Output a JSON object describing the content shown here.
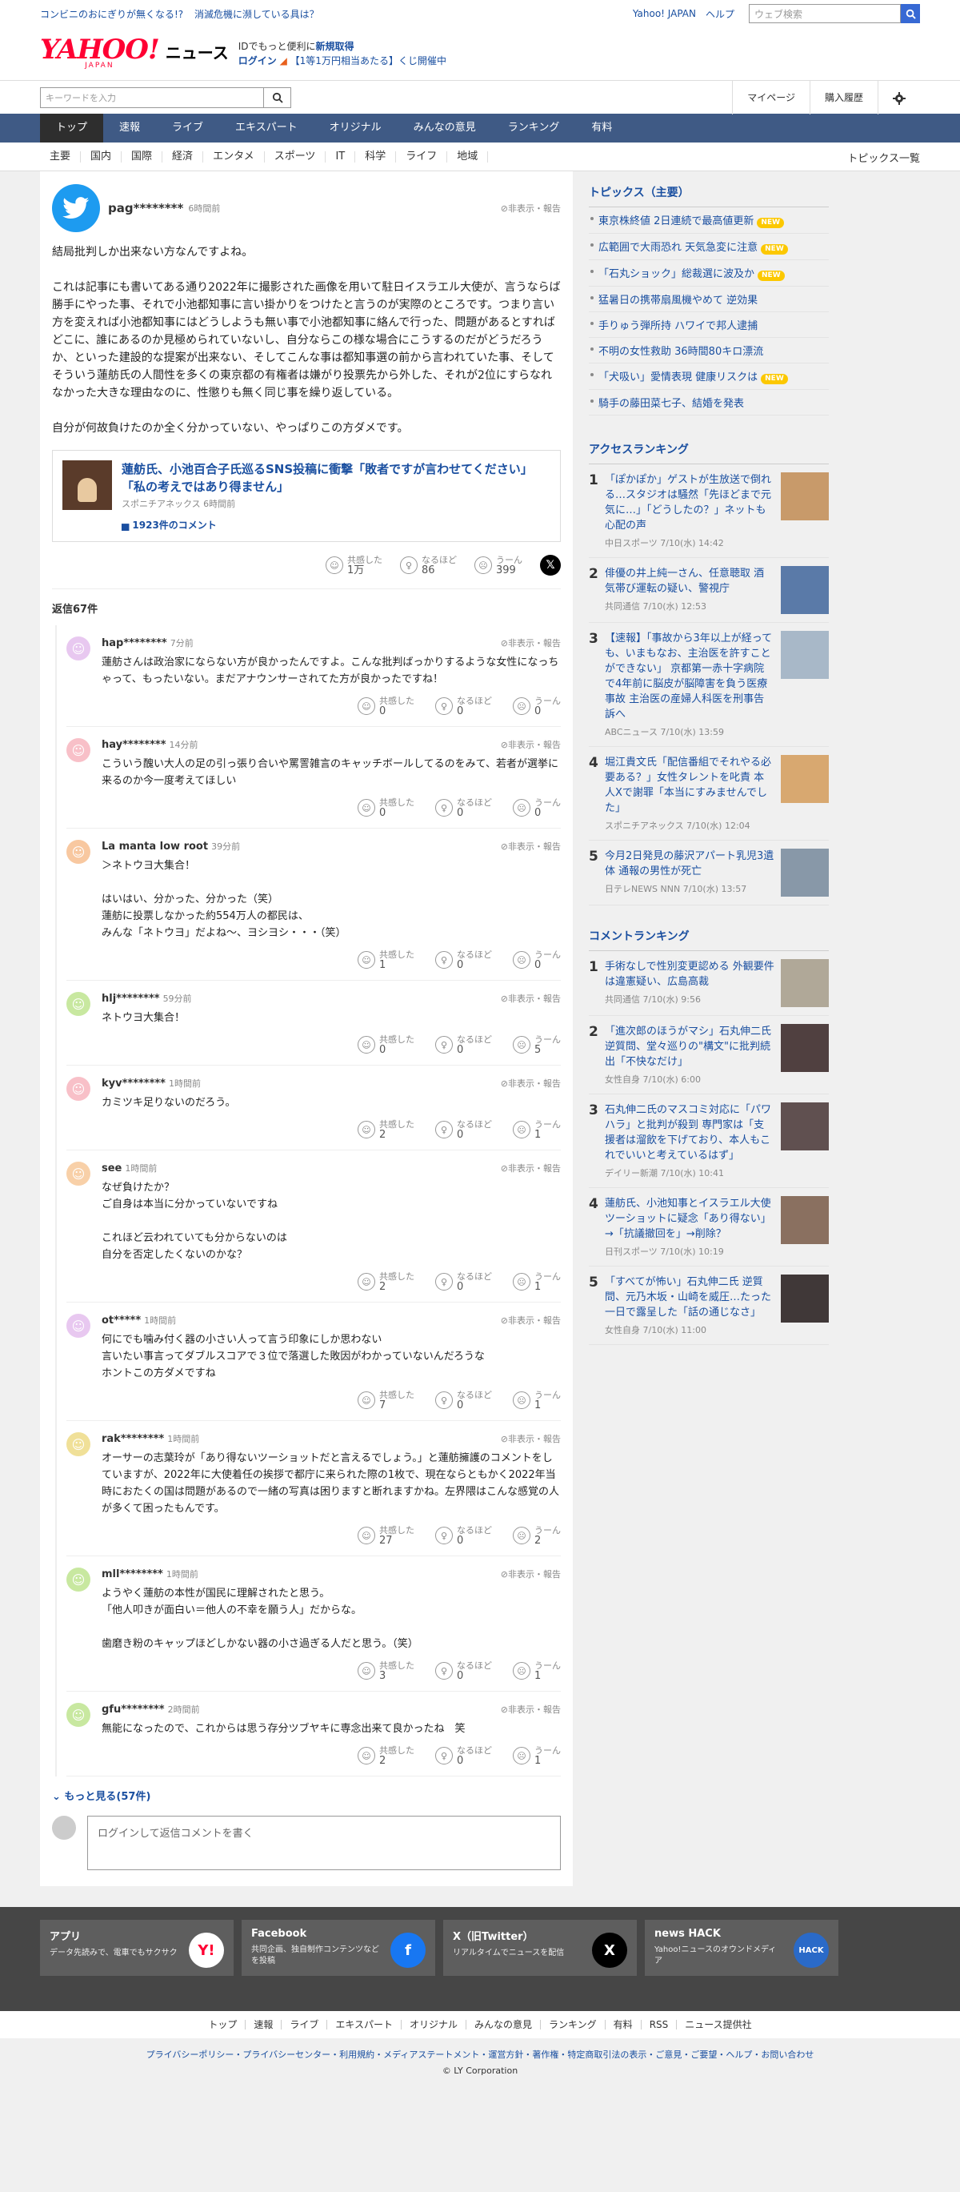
{
  "topbar": {
    "promos": [
      "コンビニのおにぎりが無くなる!?",
      "消滅危機に瀕している具は？"
    ],
    "yahoo_japan": "Yahoo! JAPAN",
    "help": "ヘルプ",
    "web_search_placeholder": "ウェブ検索"
  },
  "header": {
    "logo_yahoo": "YAHOO!",
    "logo_japan": "JAPAN",
    "logo_news": "ニュース",
    "msg_prefix": "IDでもっと便利に",
    "msg_signup": "新規取得",
    "login": "ログイン",
    "lottery": "【1等1万円相当あたる】くじ開催中"
  },
  "searchbar": {
    "placeholder": "キーワードを入力",
    "mypage": "マイページ",
    "history": "購入履歴"
  },
  "nav": {
    "tabs": [
      "トップ",
      "速報",
      "ライブ",
      "エキスパート",
      "オリジナル",
      "みんなの意見",
      "ランキング",
      "有料"
    ]
  },
  "subnav": {
    "items": [
      "主要",
      "国内",
      "国際",
      "経済",
      "エンタメ",
      "スポーツ",
      "IT",
      "科学",
      "ライフ",
      "地域"
    ],
    "all": "トピックス一覧"
  },
  "post": {
    "user": "pag********",
    "time": "6時間前",
    "report": "非表示・報告",
    "text": "結局批判しか出来ない方なんですよね。\n\nこれは記事にも書いてある通り2022年に撮影された画像を用いて駐日イスラエル大使が、言うならば勝手にやった事、それで小池都知事に言い掛かりをつけたと言うのが実際のところです。つまり言い方を変えれば小池都知事にはどうしようも無い事で小池都知事に絡んで行った、問題があるとすればどこに、誰にあるのか見極められていないし、自分ならこの様な場合にこうするのだがどうだろうか、といった建設的な提案が出来ない、そしてこんな事は都知事選の前から言われていた事、そしてそういう蓮舫氏の人間性を多くの東京都の有権者は嫌がり投票先から外した、それが2位にすらなれなかった大きな理由なのに、性懲りも無く同じ事を繰り返している。\n\n自分が何故負けたのか全く分かっていない、やっぱりこの方ダメです。",
    "article": {
      "title": "蓮舫氏、小池百合子氏巡るSNS投稿に衝撃「敗者ですが言わせてください」「私の考えではあり得ません」",
      "source": "スポニチアネックス 6時間前",
      "comments": "1923件のコメント"
    },
    "reactions": {
      "agree_label": "共感した",
      "agree": "1万",
      "naruhodo_label": "なるほど",
      "naruhodo": "86",
      "uun_label": "うーん",
      "uun": "399"
    }
  },
  "replies_label": "返信67件",
  "replies": [
    {
      "user": "hap********",
      "time": "7分前",
      "text": "蓮舫さんは政治家にならない方が良かったんですよ。こんな批判ばっかりするような女性になっちゃって、もったいない。まだアナウンサーされてた方が良かったですね！",
      "agree": "0",
      "naruhodo": "0",
      "uun": "0",
      "color": "#e8c8f0",
      "face": "☺"
    },
    {
      "user": "hay********",
      "time": "14分前",
      "text": "こういう醜い大人の足の引っ張り合いや罵詈雑言のキャッチボールしてるのをみて、若者が選挙に来るのか今一度考えてほしい",
      "agree": "0",
      "naruhodo": "0",
      "uun": "0",
      "color": "#f8c0c8",
      "face": "☺"
    },
    {
      "user": "La manta low root",
      "time": "39分前",
      "text": "＞ネトウヨ大集合！\n\nはいはい、分かった、分かった（笑）\n蓮舫に投票しなかった約554万人の都民は、\nみんな「ネトウヨ」だよね〜、ヨシヨシ・・・（笑）",
      "agree": "1",
      "naruhodo": "0",
      "uun": "0",
      "color": "#f8c8a0",
      "face": "☺"
    },
    {
      "user": "hlj********",
      "time": "59分前",
      "text": "ネトウヨ大集合！",
      "agree": "0",
      "naruhodo": "0",
      "uun": "5",
      "color": "#c8e8a0",
      "face": "☺"
    },
    {
      "user": "kyv********",
      "time": "1時間前",
      "text": "カミツキ足りないのだろう。",
      "agree": "2",
      "naruhodo": "0",
      "uun": "1",
      "color": "#f8c0c8",
      "face": "☺"
    },
    {
      "user": "see",
      "time": "1時間前",
      "text": "なぜ負けたか？\nご自身は本当に分かっていないですね\n\nこれほど云われていても分からないのは\n自分を否定したくないのかな？",
      "agree": "2",
      "naruhodo": "0",
      "uun": "1",
      "color": "#f8d0a8",
      "face": "☺"
    },
    {
      "user": "ot*****",
      "time": "1時間前",
      "text": "何にでも噛み付く器の小さい人って言う印象にしか思わない\n言いたい事言ってダブルスコアで３位で落選した敗因がわかっていないんだろうな\nホントこの方ダメですね",
      "agree": "7",
      "naruhodo": "0",
      "uun": "1",
      "color": "#e8c8f0",
      "face": "☺"
    },
    {
      "user": "rak********",
      "time": "1時間前",
      "text": "オーサーの志葉玲が「あり得ないツーショットだと言えるでしょう。」と蓮舫擁護のコメントをしていますが、2022年に大使着任の挨拶で都庁に来られた際の1枚で、現在ならともかく2022年当時におたくの国は問題があるので一緒の写真は困りますと断れますかね。左界隈はこんな感覚の人が多くて困ったもんです。",
      "agree": "27",
      "naruhodo": "0",
      "uun": "2",
      "color": "#f0e098",
      "face": "☺"
    },
    {
      "user": "mll********",
      "time": "1時間前",
      "text": "ようやく蓮舫の本性が国民に理解されたと思う。\n「他人叩きが面白い＝他人の不幸を願う人」だからな。\n\n歯磨き粉のキャップほどしかない器の小さ過ぎる人だと思う。（笑）",
      "agree": "3",
      "naruhodo": "0",
      "uun": "1",
      "color": "#c8e8a0",
      "face": "☺"
    },
    {
      "user": "gfu********",
      "time": "2時間前",
      "text": "無能になったので、これからは思う存分ツブヤキに専念出来て良かったね　笑",
      "agree": "2",
      "naruhodo": "0",
      "uun": "1",
      "color": "#c8e8a0",
      "face": "☺"
    }
  ],
  "more": "もっと見る(57件)",
  "reply_placeholder": "ログインして返信コメントを書く",
  "side": {
    "topics_title": "トピックス（主要）",
    "topics": [
      {
        "text": "東京株終値 2日連続で最高値更新",
        "new": "NEW"
      },
      {
        "text": "広範囲で大雨恐れ 天気急変に注意",
        "new": "NEW"
      },
      {
        "text": "「石丸ショック」総裁選に波及か",
        "new": "NEW"
      },
      {
        "text": "猛暑日の携帯扇風機やめて 逆効果",
        "new": ""
      },
      {
        "text": "手りゅう弾所持 ハワイで邦人逮捕",
        "new": ""
      },
      {
        "text": "不明の女性救助 36時間80キロ漂流",
        "new": ""
      },
      {
        "text": "「犬吸い」愛情表現 健康リスクは",
        "new": "NEW"
      },
      {
        "text": "騎手の藤田菜七子、結婚を発表",
        "new": ""
      }
    ],
    "access_title": "アクセスランキング",
    "access": [
      {
        "num": "1",
        "text": "「ぽかぽか」ゲストが生放送で倒れる…スタジオは騒然「先ほどまで元気に…」「どうしたの？」ネットも心配の声",
        "src": "中日スポーツ 7/10(水) 14:42",
        "img": "#c89a6a"
      },
      {
        "num": "2",
        "text": "俳優の井上純一さん、任意聴取 酒気帯び運転の疑い、警視庁",
        "src": "共同通信 7/10(水) 12:53",
        "img": "#5a7aa8"
      },
      {
        "num": "3",
        "text": "【速報】「事故から3年以上が経っても、いまもなお、主治医を許すことができない」 京都第一赤十字病院で4年前に脳皮が脳障害を負う医療事故 主治医の産婦人科医を刑事告訴へ",
        "src": "ABCニュース 7/10(水) 13:59",
        "img": "#a8b8c8"
      },
      {
        "num": "4",
        "text": "堀江貴文氏「配信番組でそれやる必要ある？」女性タレントを叱責 本人Xで謝罪「本当にすみませんでした」",
        "src": "スポニチアネックス 7/10(水) 12:04",
        "img": "#d8a870"
      },
      {
        "num": "5",
        "text": "今月2日発見の藤沢アパート乳児3遺体 通報の男性が死亡",
        "src": "日テレNEWS NNN 7/10(水) 13:57",
        "img": "#8898a8"
      }
    ],
    "comment_title": "コメントランキング",
    "comment": [
      {
        "num": "1",
        "text": "手術なしで性別変更認める 外観要件は違憲疑い、広島高裁",
        "src": "共同通信 7/10(水) 9:56",
        "img": "#b0a898"
      },
      {
        "num": "2",
        "text": "「進次郎のほうがマシ」石丸伸二氏 逆質問、堂々巡りの\"構文\"に批判続出「不快なだけ」",
        "src": "女性自身 7/10(水) 6:00",
        "img": "#504040"
      },
      {
        "num": "3",
        "text": "石丸伸二氏のマスコミ対応に「パワハラ」と批判が殺到 専門家は「支援者は溜飲を下げており、本人もこれでいいと考えているはず」",
        "src": "デイリー新潮 7/10(水) 10:41",
        "img": "#605050"
      },
      {
        "num": "4",
        "text": "蓮舫氏、小池知事とイスラエル大使ツーショットに疑念「あり得ない」→「抗議撤回を」→削除？",
        "src": "日刊スポーツ 7/10(水) 10:19",
        "img": "#8a7060"
      },
      {
        "num": "5",
        "text": "「すべてが怖い」石丸伸二氏 逆質問、元乃木坂・山崎を威圧…たった一日で露呈した「話の通じなさ」",
        "src": "女性自身 7/10(水) 11:00",
        "img": "#403838"
      }
    ]
  },
  "footer": {
    "cards": [
      {
        "title": "アプリ",
        "desc": "データ先読みで、電車でもサクサク",
        "icon": "Y!",
        "color": "#ffffff",
        "fg": "#ff0033"
      },
      {
        "title": "Facebook",
        "desc": "共同企画、独自制作コンテンツなどを投稿",
        "icon": "f",
        "color": "#1877f2",
        "fg": "#ffffff"
      },
      {
        "title": "X（旧Twitter）",
        "desc": "リアルタイムでニュースを配信",
        "icon": "X",
        "color": "#000000",
        "fg": "#ffffff"
      },
      {
        "title": "news HACK",
        "desc": "Yahoo!ニュースのオウンドメディア",
        "icon": "HACK",
        "color": "#2a6ac8",
        "fg": "#ffffff"
      }
    ],
    "nav": [
      "トップ",
      "速報",
      "ライブ",
      "エキスパート",
      "オリジナル",
      "みんなの意見",
      "ランキング",
      "有料",
      "RSS",
      "ニュース提供社"
    ],
    "links": "プライバシーポリシー・プライバシーセンター・利用規約・メディアステートメント・運営方針・著作権・特定商取引法の表示・ご意見・ご要望・ヘルプ・お問い合わせ",
    "copy": "© LY Corporation"
  }
}
